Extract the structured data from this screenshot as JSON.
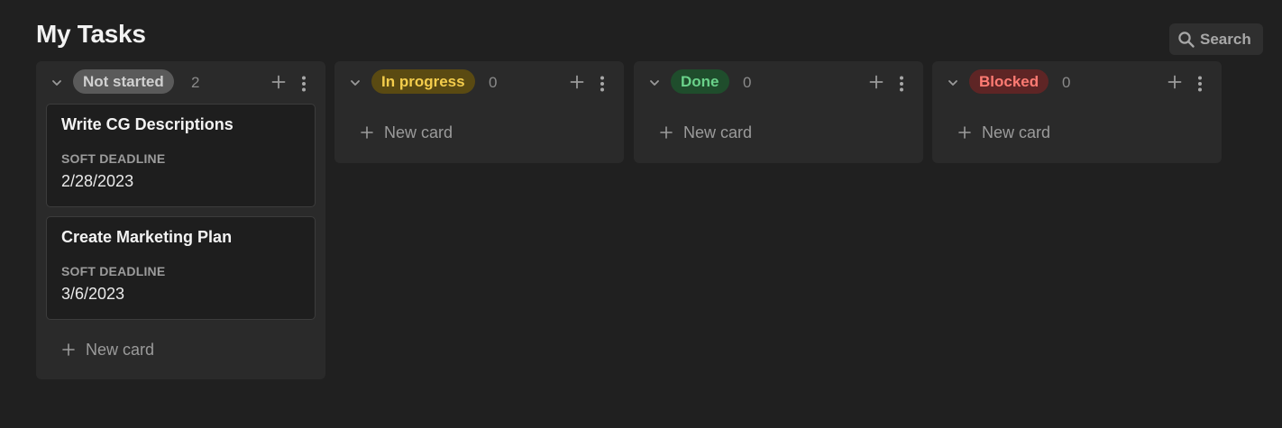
{
  "page": {
    "title": "My Tasks"
  },
  "toolbar": {
    "search_label": "Search",
    "search_icon": "search-icon"
  },
  "board": {
    "new_card_label": "New card",
    "columns": [
      {
        "status": "Not started",
        "count": "2",
        "pill_bg": "#5a5a5a",
        "pill_fg": "#d0d0d0",
        "cards": [
          {
            "title": "Write CG Descriptions",
            "prop_label": "SOFT DEADLINE",
            "prop_value": "2/28/2023"
          },
          {
            "title": "Create Marketing Plan",
            "prop_label": "SOFT DEADLINE",
            "prop_value": "3/6/2023"
          }
        ]
      },
      {
        "status": "In progress",
        "count": "0",
        "pill_bg": "#5a4a12",
        "pill_fg": "#f4cd4c",
        "cards": []
      },
      {
        "status": "Done",
        "count": "0",
        "pill_bg": "#1f4d2c",
        "pill_fg": "#6ad28a",
        "cards": []
      },
      {
        "status": "Blocked",
        "count": "0",
        "pill_bg": "#5e2525",
        "pill_fg": "#ff7b73",
        "cards": []
      }
    ]
  }
}
